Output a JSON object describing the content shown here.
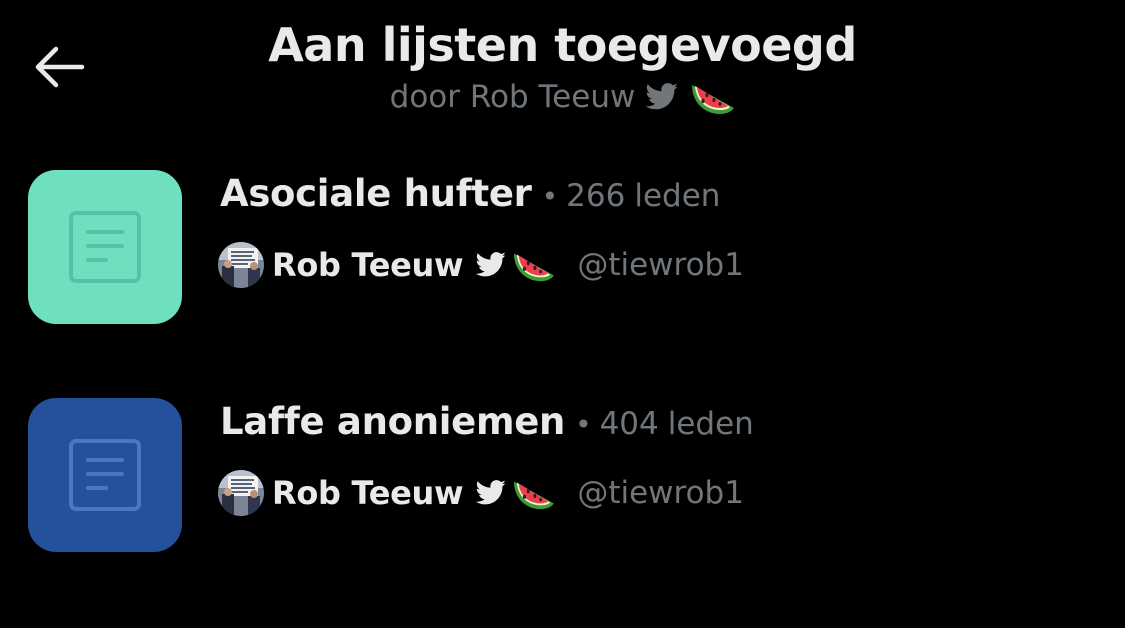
{
  "header": {
    "back_icon": "arrow-left-icon",
    "title": "Aan lijsten toegevoegd",
    "subtitle_prefix": "door Rob Teeuw"
  },
  "lists": [
    {
      "name": "Asociale hufter",
      "separator": "•",
      "member_count": "266",
      "member_label": "leden",
      "thumb_color": "#6ee0c0",
      "thumb_icon_color": "#52c3a4",
      "owner_name": "Rob Teeuw",
      "owner_handle": "@tiewrob1"
    },
    {
      "name": "Laffe anoniemen",
      "separator": "•",
      "member_count": "404",
      "member_label": "leden",
      "thumb_color": "#25509c",
      "thumb_icon_color": "#4a77c4",
      "owner_name": "Rob Teeuw",
      "owner_handle": "@tiewrob1"
    }
  ],
  "icons": {
    "bird": "bird-icon",
    "watermelon": "watermelon-icon",
    "list": "list-document-icon"
  },
  "colors": {
    "background": "#000000",
    "primary_text": "#e7e9ea",
    "secondary_text": "#71767b"
  }
}
